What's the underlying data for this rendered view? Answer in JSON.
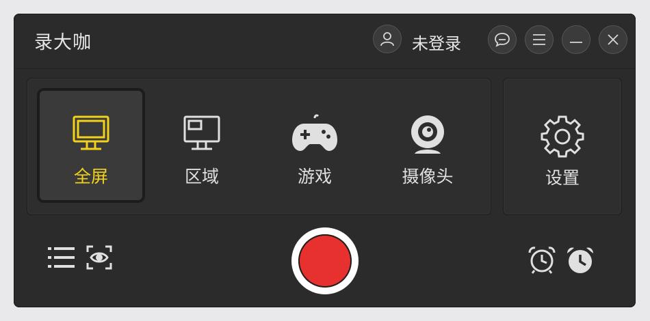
{
  "titlebar": {
    "app_title": "录大咖",
    "login_label": "未登录",
    "icons": [
      "user-icon",
      "message-icon",
      "menu-icon",
      "minimize-icon",
      "close-icon"
    ]
  },
  "modes": [
    {
      "label": "全屏",
      "icon": "monitor-icon",
      "active": true
    },
    {
      "label": "区域",
      "icon": "region-icon",
      "active": false
    },
    {
      "label": "游戏",
      "icon": "gamepad-icon",
      "active": false
    },
    {
      "label": "摄像头",
      "icon": "webcam-icon",
      "active": false
    }
  ],
  "settings": {
    "label": "设置",
    "icon": "gear-icon"
  },
  "toolbar": {
    "left_icons": [
      "list-icon",
      "preview-eye-icon"
    ],
    "center": "record-icon",
    "right_icons": [
      "alarm-clock-icon",
      "timer-clock-icon"
    ]
  },
  "colors": {
    "background": "#2b2b2b",
    "active_accent": "#f3d21c",
    "record_red": "#e7312e",
    "text": "#e0e0e0"
  }
}
